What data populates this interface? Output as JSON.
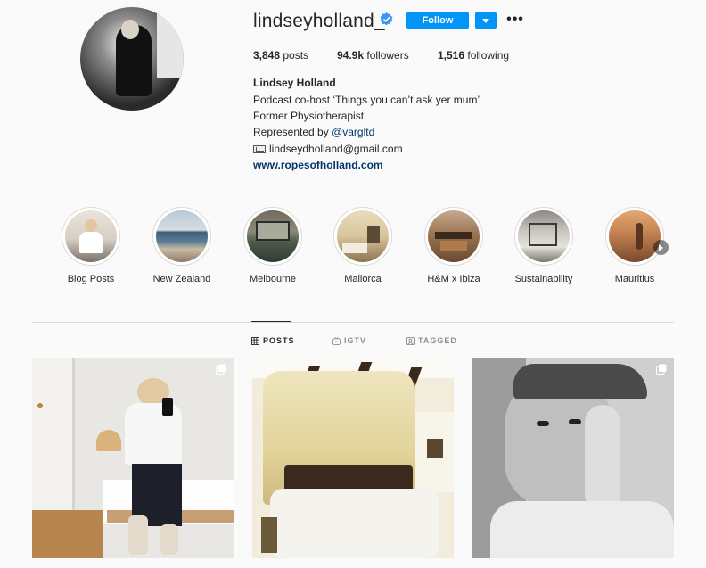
{
  "profile": {
    "username": "lindseyholland_",
    "follow_label": "Follow",
    "stats": {
      "posts_count": "3,848",
      "posts_label": "posts",
      "followers_count": "94.9k",
      "followers_label": "followers",
      "following_count": "1,516",
      "following_label": "following"
    },
    "bio": {
      "full_name": "Lindsey Holland",
      "line1": "Podcast co-host ‘Things you can’t ask yer mum’",
      "line2": "Former Physiotherapist",
      "line3_prefix": "Represented by ",
      "line3_mention": "@vargltd",
      "email": "lindseydholland@gmail.com",
      "website": "www.ropesofholland.com"
    }
  },
  "highlights": [
    {
      "label": "Blog Posts"
    },
    {
      "label": "New Zealand"
    },
    {
      "label": "Melbourne"
    },
    {
      "label": "Mallorca"
    },
    {
      "label": "H&M x Ibiza"
    },
    {
      "label": "Sustainability"
    },
    {
      "label": "Mauritius"
    }
  ],
  "tabs": [
    {
      "label": "POSTS",
      "icon": "grid-icon",
      "active": true
    },
    {
      "label": "IGTV",
      "icon": "igtv-icon",
      "active": false
    },
    {
      "label": "TAGGED",
      "icon": "tagged-icon",
      "active": false
    }
  ],
  "colors": {
    "accent": "#0095f6",
    "link": "#00376b",
    "background": "#fafafa"
  }
}
